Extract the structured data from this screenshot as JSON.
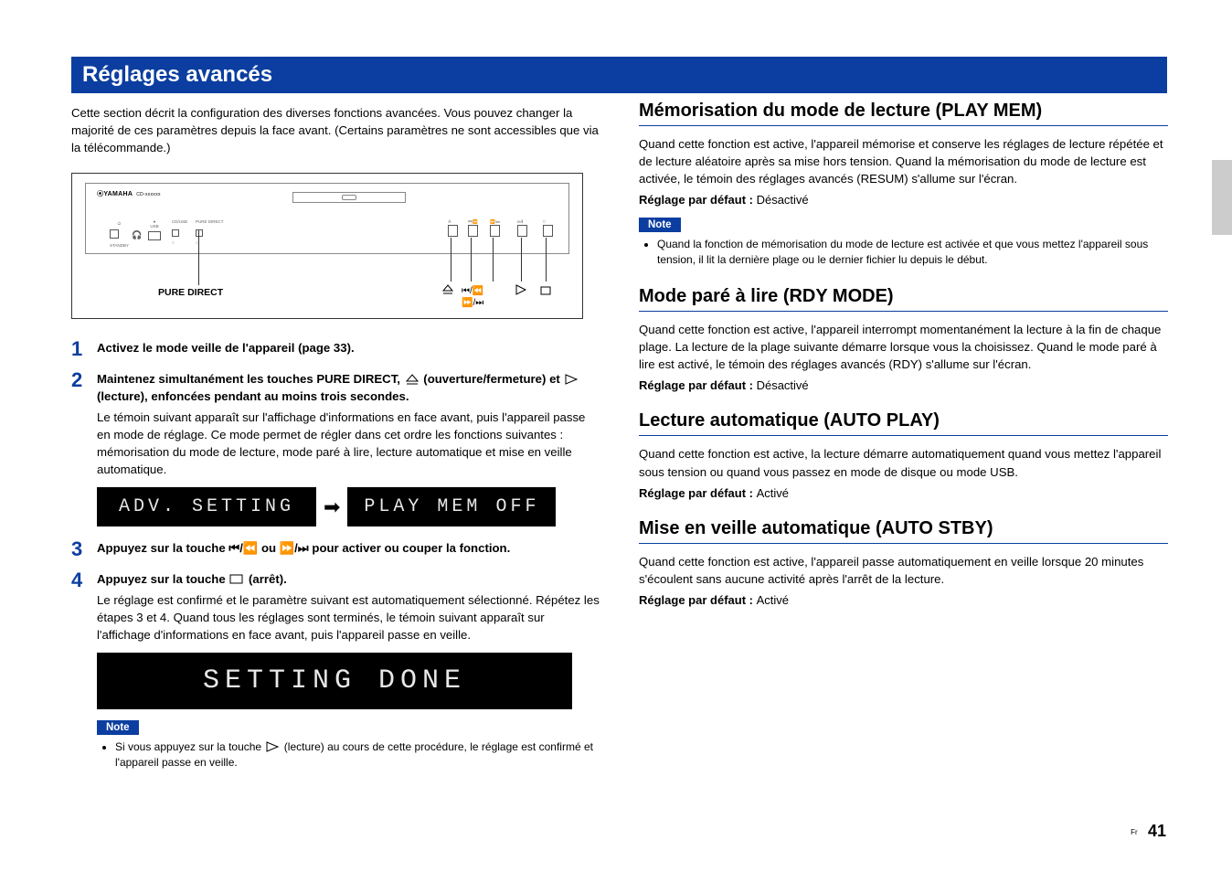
{
  "banner": "Réglages avancés",
  "intro": "Cette section décrit la configuration des diverses fonctions avancées. Vous pouvez changer la majorité de ces paramètres depuis la face avant. (Certains paramètres ne sont accessibles que via la télécommande.)",
  "device": {
    "brand": "YAMAHA",
    "model": "CD-xxxxxx",
    "pure_direct_label": "PURE DIRECT"
  },
  "step1": {
    "title": "Activez le mode veille de l'appareil (page 33)."
  },
  "step2": {
    "title_a": "Maintenez simultanément les touches PURE DIRECT, ",
    "title_b": " (ouverture/fermeture) et ",
    "title_c": " (lecture), enfoncées pendant au moins trois secondes.",
    "body": "Le témoin suivant apparaît sur l'affichage d'informations en face avant, puis l'appareil passe en mode de réglage. Ce mode permet de régler dans cet ordre les fonctions suivantes : mémorisation du mode de lecture, mode paré à lire, lecture automatique et mise en veille automatique."
  },
  "lcd1": "ADV. SETTING",
  "lcd2": "PLAY MEM OFF",
  "step3": {
    "title_a": "Appuyez sur la touche ",
    "title_b": " ou ",
    "title_c": " pour activer ou couper la fonction."
  },
  "step4": {
    "title_a": "Appuyez sur la touche ",
    "title_b": " (arrêt).",
    "body": "Le réglage est confirmé et le paramètre suivant est automatiquement sélectionné. Répétez les étapes 3 et 4. Quand tous les réglages sont terminés, le témoin suivant apparaît sur l'affichage d'informations en face avant, puis l'appareil passe en veille."
  },
  "lcd3": "SETTING DONE",
  "note_label": "Note",
  "note_left_a": "Si vous appuyez sur la touche ",
  "note_left_b": " (lecture) au cours de cette procédure, le réglage est confirmé et l'appareil passe en veille.",
  "sec_playmem": {
    "h": "Mémorisation du mode de lecture (PLAY MEM)",
    "p": "Quand cette fonction est active, l'appareil mémorise et conserve les réglages de lecture répétée et de lecture aléatoire après sa mise hors tension. Quand la mémorisation du mode de lecture est activée, le témoin des réglages avancés (RESUM) s'allume sur l'écran.",
    "def_label": "Réglage par défaut : ",
    "def_val": "Désactivé",
    "note": "Quand la fonction de mémorisation du mode de lecture est activée et que vous mettez l'appareil sous tension, il lit la dernière plage ou le dernier fichier lu depuis le début."
  },
  "sec_rdy": {
    "h": "Mode paré à lire (RDY MODE)",
    "p": "Quand cette fonction est active, l'appareil interrompt momentanément la lecture à la fin de chaque plage. La lecture de la plage suivante démarre lorsque vous la choisissez. Quand le mode paré à lire est activé, le témoin des réglages avancés (RDY) s'allume sur l'écran.",
    "def_label": "Réglage par défaut : ",
    "def_val": "Désactivé"
  },
  "sec_auto": {
    "h": "Lecture automatique (AUTO PLAY)",
    "p": "Quand cette fonction est active, la lecture démarre automatiquement quand vous mettez l'appareil sous tension ou quand vous passez en mode de disque ou mode USB.",
    "def_label": "Réglage par défaut : ",
    "def_val": "Activé"
  },
  "sec_stby": {
    "h": "Mise en veille automatique (AUTO STBY)",
    "p": "Quand cette fonction est active, l'appareil passe automatiquement en veille lorsque 20 minutes s'écoulent sans aucune activité après l'arrêt de la lecture.",
    "def_label": "Réglage par défaut : ",
    "def_val": "Activé"
  },
  "footer": {
    "lang": "Fr",
    "page": "41"
  }
}
